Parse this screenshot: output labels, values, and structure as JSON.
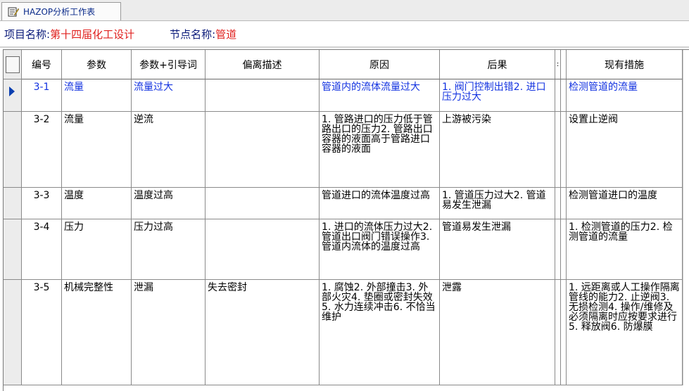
{
  "tab": {
    "label": "HAZOP分析工作表"
  },
  "header": {
    "project_label": "项目名称:",
    "project_value": "第十四届化工设计",
    "node_label": "节点名称:",
    "node_value": "管道"
  },
  "columns": {
    "id": "编号",
    "param": "参数",
    "guide": "参数+引导词",
    "deviation": "偏离描述",
    "cause": "原因",
    "consequence": "后果",
    "narrow1": ":",
    "measures": "现有措施"
  },
  "rows": [
    {
      "id": "3-1",
      "param": "流量",
      "guide": "流量过大",
      "deviation": "",
      "cause": "管道内的流体流量过大",
      "consequence": "1. 阀门控制出错2. 进口压力过大",
      "measures": "检测管道的流量"
    },
    {
      "id": "3-2",
      "param": "流量",
      "guide": "逆流",
      "deviation": "",
      "cause": "1. 管路进口的压力低于管路出口的压力2. 管路出口容器的液面高于管路进口容器的液面",
      "consequence": "上游被污染",
      "measures": "设置止逆阀"
    },
    {
      "id": "3-3",
      "param": "温度",
      "guide": "温度过高",
      "deviation": "",
      "cause": "管道进口的流体温度过高",
      "consequence": "1. 管道压力过大2. 管道易发生泄漏",
      "measures": "检测管道进口的温度"
    },
    {
      "id": "3-4",
      "param": "压力",
      "guide": "压力过高",
      "deviation": "",
      "cause": "1. 进口的流体压力过大2. 管道出口阀门错误操作3. 管道内流体的温度过高",
      "consequence": "管道易发生泄漏",
      "measures": "1. 检测管道的压力2. 检测管道的流量"
    },
    {
      "id": "3-5",
      "param": "机械完整性",
      "guide": "泄漏",
      "deviation": "失去密封",
      "cause": "1. 腐蚀2. 外部撞击3. 外部火灾4. 垫圈或密封失效5. 水力连续冲击6. 不恰当维护",
      "consequence": "泄露",
      "measures": "1. 远距离或人工操作隔离管线的能力2. 止逆阀3. 无损检测4. 操作/维修及必须隔离时应按要求进行5. 释放阀6. 防爆膜"
    }
  ],
  "colors": {
    "current_row_text": "#1232e0",
    "project_value": "#e0201e",
    "label": "#0a1a7a",
    "record_selector": "#0b3fb0"
  }
}
